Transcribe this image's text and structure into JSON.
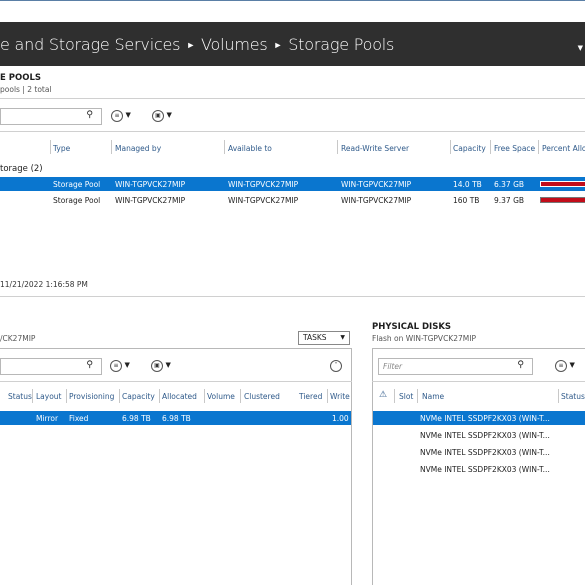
{
  "breadcrumb": [
    "e and Storage Services",
    "Volumes",
    "Storage Pools"
  ],
  "pools_section": {
    "title": "E POOLS",
    "subtitle": "pools | 2 total",
    "group_label": "torage (2)",
    "columns": [
      "Type",
      "Managed by",
      "Available to",
      "Read-Write Server",
      "Capacity",
      "Free Space",
      "Percent Allo"
    ],
    "rows": [
      {
        "type": "Storage Pool",
        "managed_by": "WIN-TGPVCK27MIP",
        "available_to": "WIN-TGPVCK27MIP",
        "rw_server": "WIN-TGPVCK27MIP",
        "capacity": "14.0 TB",
        "free": "6.37 GB",
        "percent": 0.99,
        "selected": true
      },
      {
        "type": "Storage Pool",
        "managed_by": "WIN-TGPVCK27MIP",
        "available_to": "WIN-TGPVCK27MIP",
        "rw_server": "WIN-TGPVCK27MIP",
        "capacity": "160 TB",
        "free": "9.37 GB",
        "percent": 0.99,
        "selected": false
      }
    ],
    "timestamp": "11/21/2022 1:16:58 PM"
  },
  "vdisks_section": {
    "subtitle": "/CK27MIP",
    "tasks_label": "TASKS",
    "columns": [
      "Status",
      "Layout",
      "Provisioning",
      "Capacity",
      "Allocated",
      "Volume",
      "Clustered",
      "Tiered",
      "Write"
    ],
    "row": {
      "layout": "Mirror",
      "provisioning": "Fixed",
      "capacity": "6.98 TB",
      "allocated": "6.98 TB",
      "write": "1.00"
    }
  },
  "physical_section": {
    "title": "PHYSICAL DISKS",
    "subtitle": "Flash on WIN-TGPVCK27MIP",
    "filter_placeholder": "Filter",
    "columns": [
      "Slot",
      "Name",
      "Status"
    ],
    "disks": [
      "NVMe INTEL SSDPF2KX03 (WIN-T...",
      "NVMe INTEL SSDPF2KX03 (WIN-T...",
      "NVMe INTEL SSDPF2KX03 (WIN-T...",
      "NVMe INTEL SSDPF2KX03 (WIN-T..."
    ]
  },
  "colors": {
    "title_bg": "#2f2f2f",
    "selection": "#0a76cf",
    "capacity_bar": "#c20d1a",
    "header_link": "#2f5a8a"
  }
}
